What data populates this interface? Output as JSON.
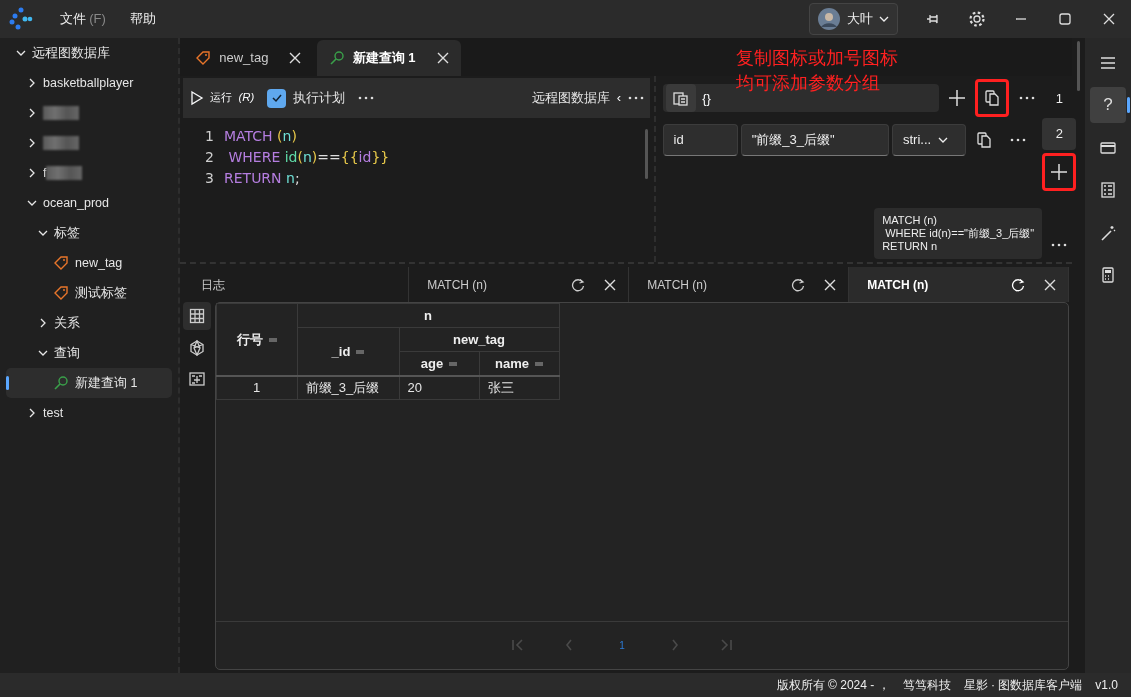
{
  "menu": [
    {
      "label": "文件",
      "shortcut": "(F)"
    },
    {
      "label": "帮助"
    }
  ],
  "user": {
    "name": "大叶"
  },
  "sidebar": {
    "tree": [
      {
        "label": "远程图数据库",
        "expanded": true,
        "children": [
          {
            "label": "basketballplayer",
            "expanded": false
          },
          {
            "redacted": true,
            "expanded": false
          },
          {
            "redacted": true,
            "expanded": false
          },
          {
            "label": "f",
            "redacted": true,
            "expanded": false
          },
          {
            "label": "ocean_prod",
            "expanded": true,
            "children": [
              {
                "label": "标签",
                "expanded": true,
                "children": [
                  {
                    "label": "new_tag",
                    "kind": "tag",
                    "selected": false
                  },
                  {
                    "label": "测试标签",
                    "kind": "tag",
                    "selected": false
                  }
                ]
              },
              {
                "label": "关系",
                "expanded": false
              },
              {
                "label": "查询",
                "expanded": true,
                "children": [
                  {
                    "label": "新建查询 1",
                    "kind": "query",
                    "selected": true
                  }
                ]
              }
            ]
          },
          {
            "label": "test",
            "expanded": false
          }
        ]
      }
    ]
  },
  "tabs": [
    {
      "label": "new_tag",
      "kind": "tag",
      "selected": false
    },
    {
      "label": "新建查询 1",
      "kind": "query",
      "selected": true
    }
  ],
  "editor": {
    "run": {
      "label": "运行",
      "shortcut": "(R)"
    },
    "plan": {
      "label": "执行计划",
      "checked": true
    },
    "database": "远程图数据库",
    "back": "‹",
    "lines": [
      {
        "number": "1",
        "tokens": [
          {
            "text": "MATCH ",
            "kind": "keyword"
          },
          {
            "text": "(",
            "kind": "paren"
          },
          {
            "text": "n",
            "kind": "var"
          },
          {
            "text": ")",
            "kind": "paren"
          }
        ]
      },
      {
        "number": "2",
        "tokens": [
          {
            "text": " WHERE ",
            "kind": "keyword"
          },
          {
            "text": "id",
            "kind": "func"
          },
          {
            "text": "(",
            "kind": "paren"
          },
          {
            "text": "n",
            "kind": "var"
          },
          {
            "text": ")",
            "kind": "paren"
          },
          {
            "text": "==",
            "kind": "op"
          },
          {
            "text": "{{",
            "kind": "paren"
          },
          {
            "text": "id",
            "kind": "keyword"
          },
          {
            "text": "}}",
            "kind": "paren"
          }
        ]
      },
      {
        "number": "3",
        "tokens": [
          {
            "text": "RETURN ",
            "kind": "keyword"
          },
          {
            "text": "n",
            "kind": "var"
          },
          {
            "text": ";",
            "kind": "op"
          }
        ]
      }
    ]
  },
  "annotation": [
    "复制图标或加号图标",
    "均可添加参数分组"
  ],
  "params": {
    "format_label": "{}",
    "header_copy": {
      "highlighted": true
    },
    "rows": [
      {
        "name": "id",
        "value": "\"前缀_3_后缀\"",
        "type": "stri..."
      }
    ],
    "groups": [
      {
        "label": "1",
        "selected": false
      },
      {
        "label": "2",
        "selected": true
      }
    ],
    "add_group": {
      "highlighted": true
    },
    "preview": "MATCH (n)\n WHERE id(n)==\"前缀_3_后缀\"\nRETURN n"
  },
  "results": {
    "tabs": [
      {
        "label": "日志",
        "closable": false,
        "selected": false
      },
      {
        "label": "MATCH (n)",
        "closable": true,
        "selected": false
      },
      {
        "label": "MATCH (n)",
        "closable": true,
        "selected": false
      },
      {
        "label": "MATCH (n)",
        "closable": true,
        "selected": true
      }
    ],
    "views": [
      {
        "kind": "table",
        "selected": true
      },
      {
        "kind": "graph",
        "selected": false
      },
      {
        "kind": "json",
        "selected": false
      }
    ],
    "table": {
      "row_number": "行号",
      "group": "n",
      "id": "_id",
      "subgroup": "new_tag",
      "fields": [
        "age",
        "name"
      ],
      "rows": [
        {
          "cells": [
            "1",
            "前缀_3_后缀",
            "20",
            "张三"
          ]
        }
      ]
    },
    "page": "1"
  },
  "rail": [
    {
      "kind": "menu",
      "selected": false
    },
    {
      "kind": "help",
      "label": "?",
      "selected": true
    },
    {
      "kind": "card",
      "selected": false
    },
    {
      "kind": "checklist",
      "selected": false
    },
    {
      "kind": "wand",
      "selected": false
    },
    {
      "kind": "calculator",
      "selected": false
    }
  ],
  "status_bar": [
    "版权所有 © 2024 - ，",
    "笃笃科技",
    "星影 · 图数据库客户端",
    "v1.0"
  ]
}
